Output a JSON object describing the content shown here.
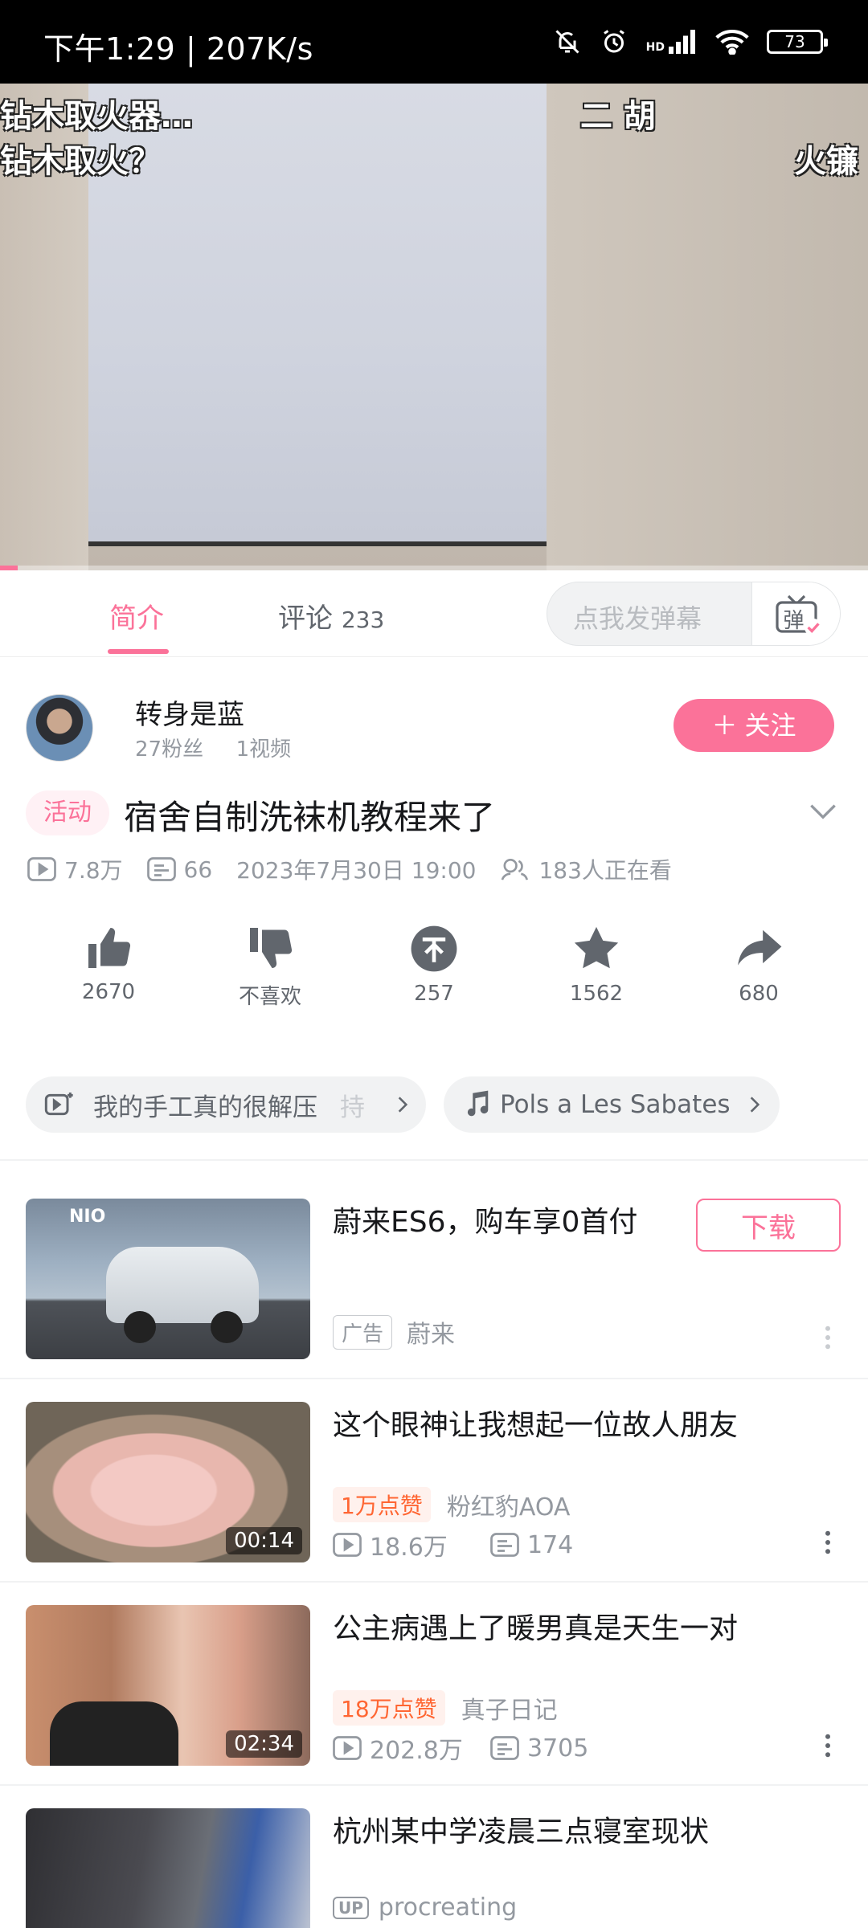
{
  "status_bar": {
    "time": "下午1:29",
    "speed": "207K/s",
    "network": "HD",
    "battery": "73"
  },
  "video": {
    "overlay_lines": [
      "钻木取火器…",
      "钻木取火？"
    ],
    "overlay_right_1": "二 胡",
    "overlay_right_2": "火镰",
    "progress": 0.02
  },
  "tabs": {
    "intro": "简介",
    "comments_label": "评论",
    "comments_count": "233",
    "danmaku_placeholder": "点我发弹幕",
    "danmaku_glyph": "弹"
  },
  "author": {
    "name": "转身是蓝",
    "fans": "27粉丝",
    "videos": "1视频",
    "follow_label": "＋ 关注"
  },
  "video_info": {
    "tag": "活动",
    "title": "宿舍自制洗袜机教程来了",
    "views": "7.8万",
    "danmaku_count": "66",
    "date": "2023年7月30日 19:00",
    "watching": "183人正在看"
  },
  "actions": {
    "like": "2670",
    "dislike": "不喜欢",
    "coin": "257",
    "favorite": "1562",
    "share": "680"
  },
  "chips": {
    "topic": "我的手工真的很解压",
    "topic_extra": "持",
    "music": "Pols a Les Sabates"
  },
  "feed": [
    {
      "title": "蔚来ES6，购车享0首付",
      "ad_label": "广告",
      "author": "蔚来",
      "button": "下载",
      "thumb_logo": "NIO"
    },
    {
      "title": "这个眼神让我想起一位故人朋友",
      "likes_badge": "1万点赞",
      "author": "粉红豹AOA",
      "views": "18.6万",
      "danmaku": "174",
      "duration": "00:14"
    },
    {
      "title": "公主病遇上了暖男真是天生一对",
      "likes_badge": "18万点赞",
      "author": "真子日记",
      "views": "202.8万",
      "danmaku": "3705",
      "duration": "02:34"
    },
    {
      "title": "杭州某中学凌晨三点寝室现状",
      "up_label": "UP",
      "author": "procreating"
    }
  ]
}
